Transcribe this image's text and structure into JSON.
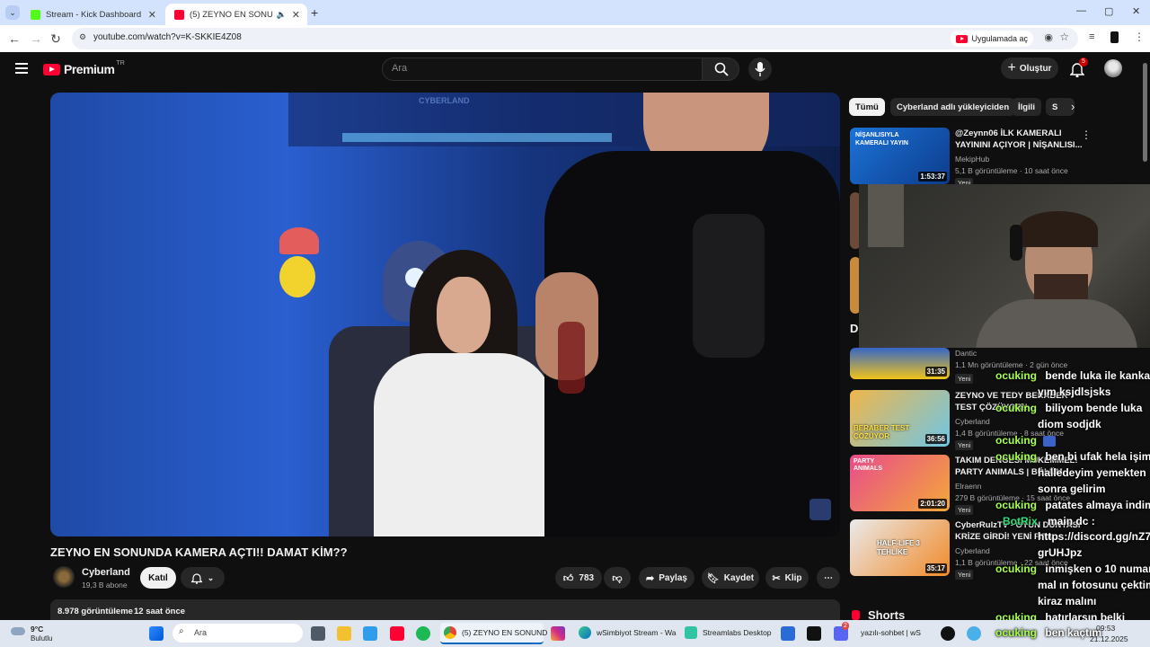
{
  "browser": {
    "tabs": [
      {
        "title": "Stream - Kick Dashboard",
        "active": false
      },
      {
        "title": "(5) ZEYNO EN SONUNDA K",
        "active": true
      }
    ],
    "url": "youtube.com/watch?v=K-SKKIE4Z08",
    "open_in_app": "Uygulamada aç"
  },
  "yt_header": {
    "logo": "Premium",
    "region": "TR",
    "search_placeholder": "Ara",
    "create_label": "Oluştur",
    "notif_count": "5"
  },
  "video": {
    "watermark": "CYBERLAND",
    "title": "ZEYNO EN SONUNDA KAMERA AÇTI!! DAMAT KİM??",
    "channel": "Cyberland",
    "subs": "19,3 B abone",
    "join_label": "Katıl",
    "likes": "783",
    "share_label": "Paylaş",
    "save_label": "Kaydet",
    "clip_label": "Klip",
    "views": "8.978 görüntüleme",
    "age": "12 saat önce"
  },
  "sidebar": {
    "chips": [
      "Tümü",
      "Cyberland adlı yükleyiciden",
      "İlgili",
      "S"
    ],
    "videos": [
      {
        "title1": "@Zeynn06 İLK KAMERALI",
        "title2": "YAYININI AÇIYOR | NİŞANLISI...",
        "channel": "MekipHub",
        "meta": "5,1 B görüntüleme · 10 saat önce",
        "duration": "1:53:37",
        "badge": "Yeni",
        "thumb_text": "NİŞANLISIYLA KAMERALI YAYIN"
      },
      {
        "title1": "",
        "title2": "",
        "channel": "Dantic",
        "meta": "1,1 Mn görüntüleme · 2 gün önce",
        "duration": "31:35",
        "badge": "Yeni"
      },
      {
        "title1": "ZEYNO VE TEDY BERABER",
        "title2": "TEST ÇÖZÜYOR!!",
        "channel": "Cyberland",
        "meta": "1,4 B görüntüleme · 8 saat önce",
        "duration": "36:56",
        "badge": "Yeni",
        "thumb_text": "BERABER TEST ÇÖZÜYOR"
      },
      {
        "title1": "TAKIM DENGESİ MÜKEMMEL!",
        "title2": "PARTY ANIMALS | BÖLÜM",
        "channel": "Elraenn",
        "meta": "279 B görüntüleme · 15 saat önce",
        "duration": "2:01:20",
        "badge": "Yeni",
        "thumb_text": "PARTY ANIMALS"
      },
      {
        "title1": "CyberRulzTV - OYUN DÜNYASI",
        "title2": "KRİZE GİRDİ! YENİ FIFA...",
        "channel": "Cyberland",
        "meta": "1,1 B görüntüleme · 22 saat önce",
        "duration": "35:17",
        "badge": "Yeni",
        "thumb_text": "HALF-LIFE 3 TEHLİKE"
      }
    ],
    "section_letter": "D",
    "shorts_label": "Shorts"
  },
  "chat": [
    {
      "name": "ocuking",
      "text": "bende luka ile kanka"
    },
    {
      "name": "",
      "text": "yım ksjdlsjsks"
    },
    {
      "name": "ocuking",
      "text": "biliyom bende luka"
    },
    {
      "name": "",
      "text": "diom sodjdk"
    },
    {
      "name": "ocuking",
      "text": ""
    },
    {
      "name": "ocuking",
      "text": "ben bi ufak hela işimi"
    },
    {
      "name": "",
      "text": "halledeyim yemekten"
    },
    {
      "name": "",
      "text": "sonra gelirim"
    },
    {
      "name": "ocuking",
      "text": "patates almaya indim"
    },
    {
      "name": "BotRix",
      "text": "main dc :"
    },
    {
      "name": "",
      "text": "https://discord.gg/nZ7"
    },
    {
      "name": "",
      "text": "grUHJpz"
    },
    {
      "name": "ocuking",
      "text": "inmişken o 10 numara"
    },
    {
      "name": "",
      "text": "mal ın fotosunu çektim"
    },
    {
      "name": "",
      "text": "kiraz malını"
    },
    {
      "name": "ocuking",
      "text": "hatırlarsın belki"
    },
    {
      "name": "ocuking",
      "text": "ben kaçtım"
    }
  ],
  "taskbar": {
    "weather_temp": "9°C",
    "weather_desc": "Bulutlu",
    "search_placeholder": "Ara",
    "apps": [
      "(5) ZEYNO EN SONUND",
      "wSimbiyot Stream - Wa",
      "Streamlabs Desktop",
      "yazılı-sohbet | wS"
    ],
    "time": "09:53",
    "date": "21.12.2025",
    "discord_badge": "2"
  }
}
